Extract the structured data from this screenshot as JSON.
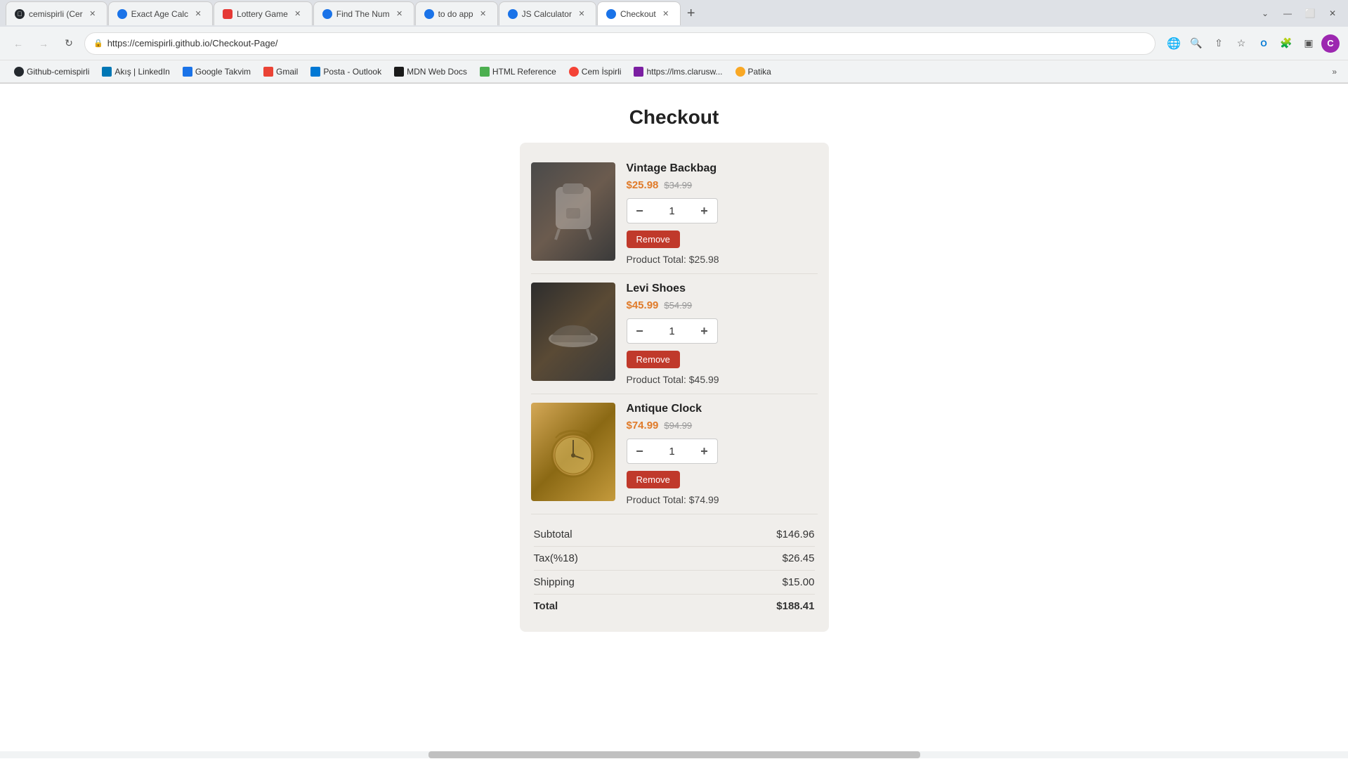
{
  "browser": {
    "tabs": [
      {
        "id": "tab-github",
        "favicon_type": "github",
        "favicon_char": "G",
        "title": "cemispirli (Cer",
        "active": false
      },
      {
        "id": "tab-age",
        "favicon_type": "green",
        "favicon_char": "",
        "title": "Exact Age Calc",
        "active": false
      },
      {
        "id": "tab-lottery",
        "favicon_type": "red",
        "favicon_char": "",
        "title": "Lottery Game",
        "active": false
      },
      {
        "id": "tab-find",
        "favicon_type": "green",
        "favicon_char": "",
        "title": "Find The Num",
        "active": false
      },
      {
        "id": "tab-todo",
        "favicon_type": "green",
        "favicon_char": "",
        "title": "to do app",
        "active": false
      },
      {
        "id": "tab-jscalc",
        "favicon_type": "green",
        "favicon_char": "",
        "title": "JS Calculator",
        "active": false
      },
      {
        "id": "tab-checkout",
        "favicon_type": "green",
        "favicon_char": "",
        "title": "Checkout",
        "active": true
      }
    ],
    "address": "https://cemispirli.github.io/Checkout-Page/"
  },
  "bookmarks": [
    {
      "id": "bm-github",
      "favicon_type": "github",
      "favicon_char": "G",
      "label": "Github-cemispirli"
    },
    {
      "id": "bm-linkedin",
      "favicon_type": "linkedin",
      "favicon_char": "in",
      "label": "Akış | LinkedIn"
    },
    {
      "id": "bm-takvim",
      "favicon_type": "blue",
      "favicon_char": "28",
      "label": "Google Takvim"
    },
    {
      "id": "bm-gmail",
      "favicon_type": "orange",
      "favicon_char": "M",
      "label": "Gmail"
    },
    {
      "id": "bm-outlook",
      "favicon_type": "blue",
      "favicon_char": "O",
      "label": "Posta - Outlook"
    },
    {
      "id": "bm-mdn",
      "favicon_type": "blue",
      "favicon_char": "M",
      "label": "MDN Web Docs"
    },
    {
      "id": "bm-html",
      "favicon_type": "purple",
      "favicon_char": "W",
      "label": "HTML Reference"
    },
    {
      "id": "bm-cem",
      "favicon_type": "green",
      "favicon_char": "C",
      "label": "Cem İspirli"
    },
    {
      "id": "bm-lms",
      "favicon_type": "purple",
      "favicon_char": "L",
      "label": "https://lms.clarusw..."
    },
    {
      "id": "bm-patika",
      "favicon_type": "yellow",
      "favicon_char": "P",
      "label": "Patika"
    }
  ],
  "page": {
    "title": "Checkout"
  },
  "products": [
    {
      "id": "prod-backpack",
      "name": "Vintage Backbag",
      "price_current": "$25.98",
      "price_original": "$34.99",
      "quantity": "1",
      "product_total_label": "Product Total:",
      "product_total": "$25.98",
      "img_class": "img-backpack",
      "remove_label": "Remove"
    },
    {
      "id": "prod-shoes",
      "name": "Levi Shoes",
      "price_current": "$45.99",
      "price_original": "$54.99",
      "quantity": "1",
      "product_total_label": "Product Total:",
      "product_total": "$45.99",
      "img_class": "img-shoes",
      "remove_label": "Remove"
    },
    {
      "id": "prod-clock",
      "name": "Antique Clock",
      "price_current": "$74.99",
      "price_original": "$94.99",
      "quantity": "1",
      "product_total_label": "Product Total:",
      "product_total": "$74.99",
      "img_class": "img-clock",
      "remove_label": "Remove"
    }
  ],
  "summary": {
    "subtotal_label": "Subtotal",
    "subtotal_value": "$146.96",
    "tax_label": "Tax(%18)",
    "tax_value": "$26.45",
    "shipping_label": "Shipping",
    "shipping_value": "$15.00",
    "total_label": "Total",
    "total_value": "$188.41"
  }
}
